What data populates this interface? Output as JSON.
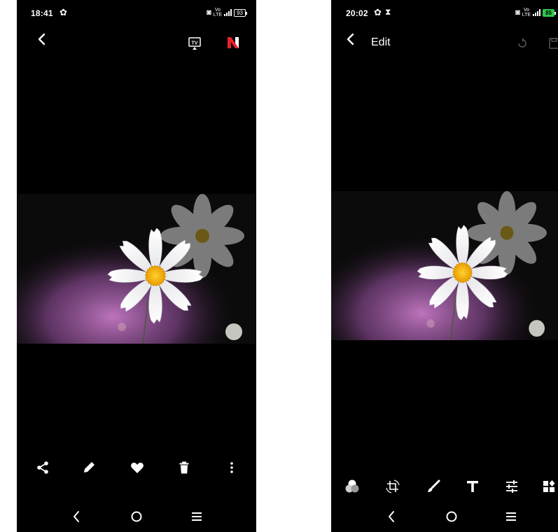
{
  "left_screen": {
    "status": {
      "time": "18:41",
      "battery": "93",
      "network": "LTE"
    },
    "toolbar": {
      "back_icon": "chevron-left-icon",
      "cast_icon": "tv-icon",
      "app_icon": "n-logo-icon",
      "app_icon_color": "#e8212b"
    },
    "bottom_actions": [
      "share-icon",
      "edit-pencil-icon",
      "favorite-heart-icon",
      "delete-trash-icon",
      "more-vert-icon"
    ]
  },
  "right_screen": {
    "status": {
      "time": "20:02",
      "battery": "85",
      "network": "LTE"
    },
    "toolbar": {
      "back_icon": "chevron-left-icon",
      "title": "Edit",
      "undo_icon": "undo-icon",
      "save_icon": "save-icon"
    },
    "edit_tools": [
      "filter-icon",
      "crop-rotate-icon",
      "brush-icon",
      "text-icon",
      "adjust-icon",
      "more-tools-icon"
    ]
  },
  "navigation": [
    "nav-back-icon",
    "nav-home-icon",
    "nav-recents-icon"
  ],
  "colors": {
    "background": "#000000",
    "battery_charging": "#2ec84a",
    "flower_center": "#f2b705"
  }
}
